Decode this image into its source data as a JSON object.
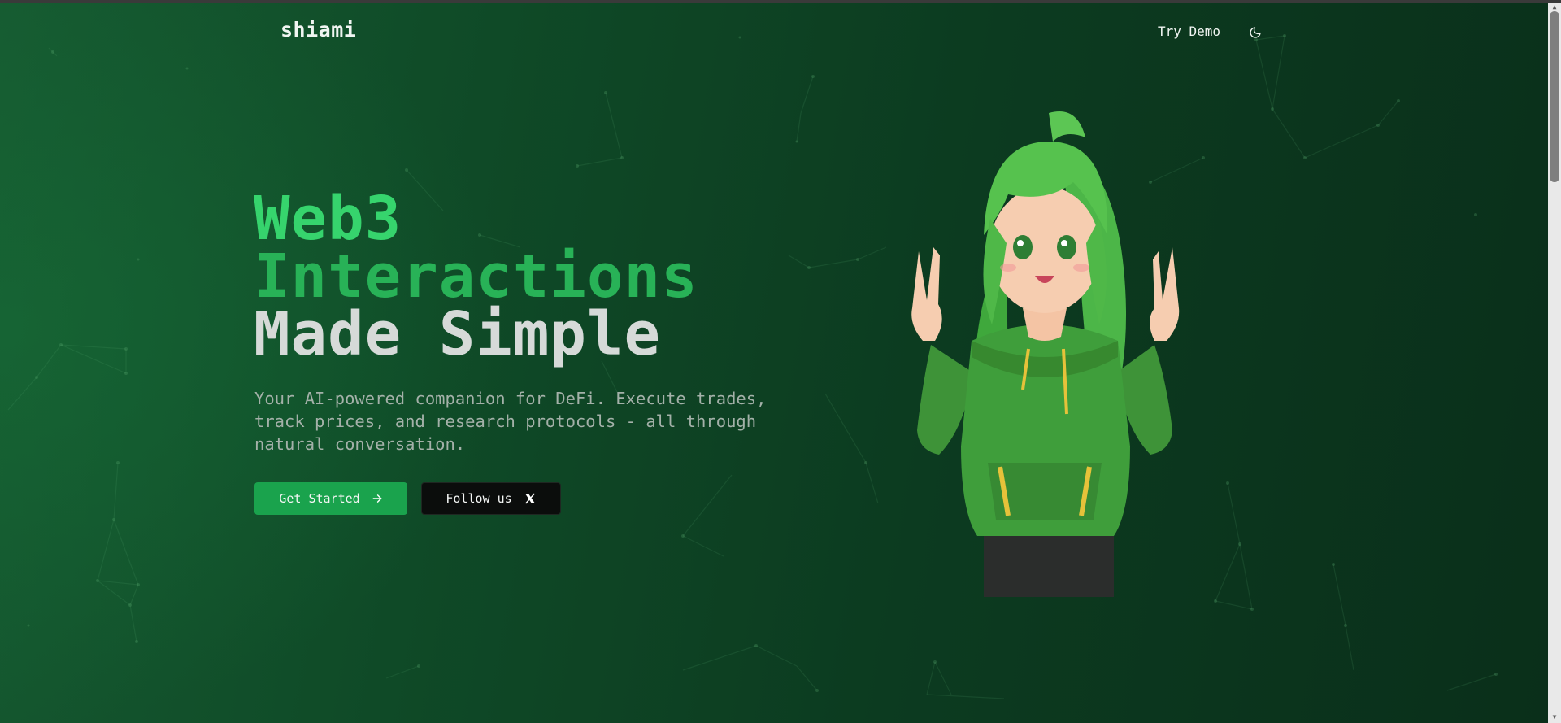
{
  "brand": {
    "name": "shiami"
  },
  "nav": {
    "try_demo": "Try Demo",
    "theme_icon": "moon-icon"
  },
  "hero": {
    "headline": [
      "Web3",
      "Interactions",
      "Made Simple"
    ],
    "subtitle": "Your AI-powered companion for DeFi. Execute trades, track prices, and research protocols - all through natural conversation.",
    "cta_primary": {
      "label": "Get Started",
      "icon": "arrow-right-icon"
    },
    "cta_secondary": {
      "label": "Follow us",
      "icon": "x-logo-icon"
    },
    "mascot_image": "anime-girl-green-hoodie-peace-sign"
  },
  "colors": {
    "background": "#0d3520",
    "accent_green": "#36d46d",
    "accent_green_dark": "#28b257",
    "button_primary": "#1aa34d",
    "button_secondary": "#0b0d0c",
    "headline_light": "#d6dad8",
    "subtitle": "#a4b1a9"
  }
}
